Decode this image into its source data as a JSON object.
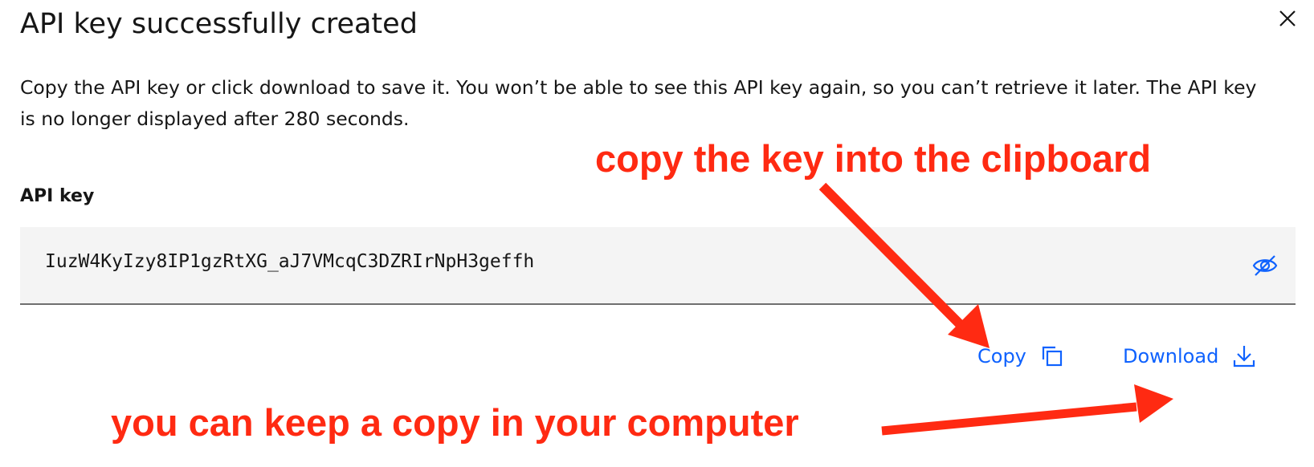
{
  "dialog": {
    "title": "API key successfully created",
    "description": "Copy the API key or click download to save it. You won’t be able to see this API key again, so you can’t retrieve it later. The API key is no longer displayed after 280 seconds.",
    "field_label": "API key",
    "key_value": "IuzW4KyIzy8IP1gzRtXG_aJ7VMcqC3DZRIrNpH3geffh",
    "copy_label": "Copy",
    "download_label": "Download"
  },
  "icons": {
    "close": "close-icon",
    "visibility": "eye-slash-icon",
    "copy": "copy-icon",
    "download": "download-icon"
  },
  "annotations": {
    "top": "copy the key into the clipboard",
    "bottom": "you can keep a copy in your computer"
  },
  "colors": {
    "accent": "#0f62fe",
    "annotation": "#ff2a12",
    "field_bg": "#f4f4f4",
    "text": "#161616"
  }
}
